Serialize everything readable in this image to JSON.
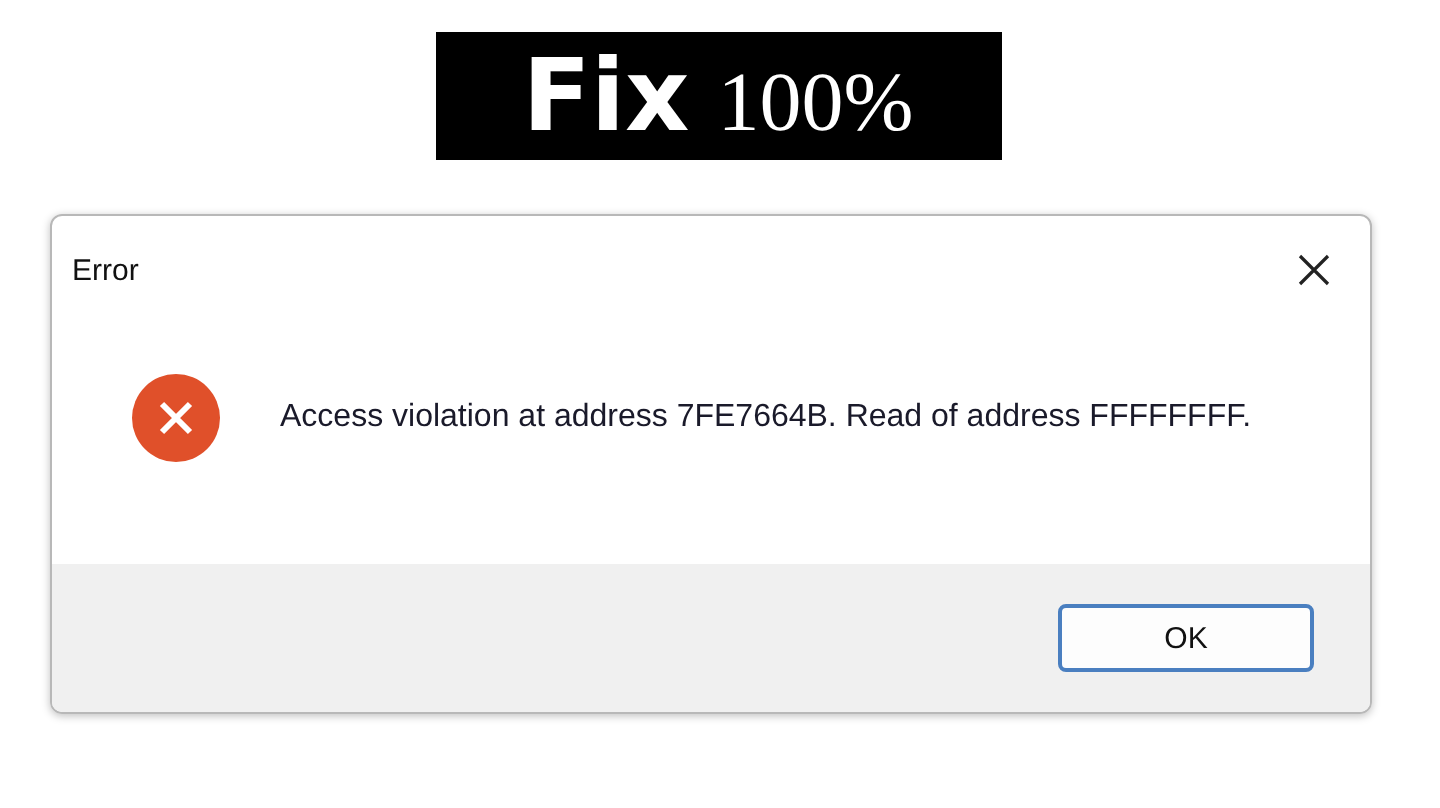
{
  "banner": {
    "word": "Fix",
    "number": "100%"
  },
  "dialog": {
    "title": "Error",
    "message": "Access violation at address 7FE7664B. Read of address FFFFFFFF.",
    "buttons": [
      {
        "label": "OK",
        "selected": true
      }
    ]
  }
}
